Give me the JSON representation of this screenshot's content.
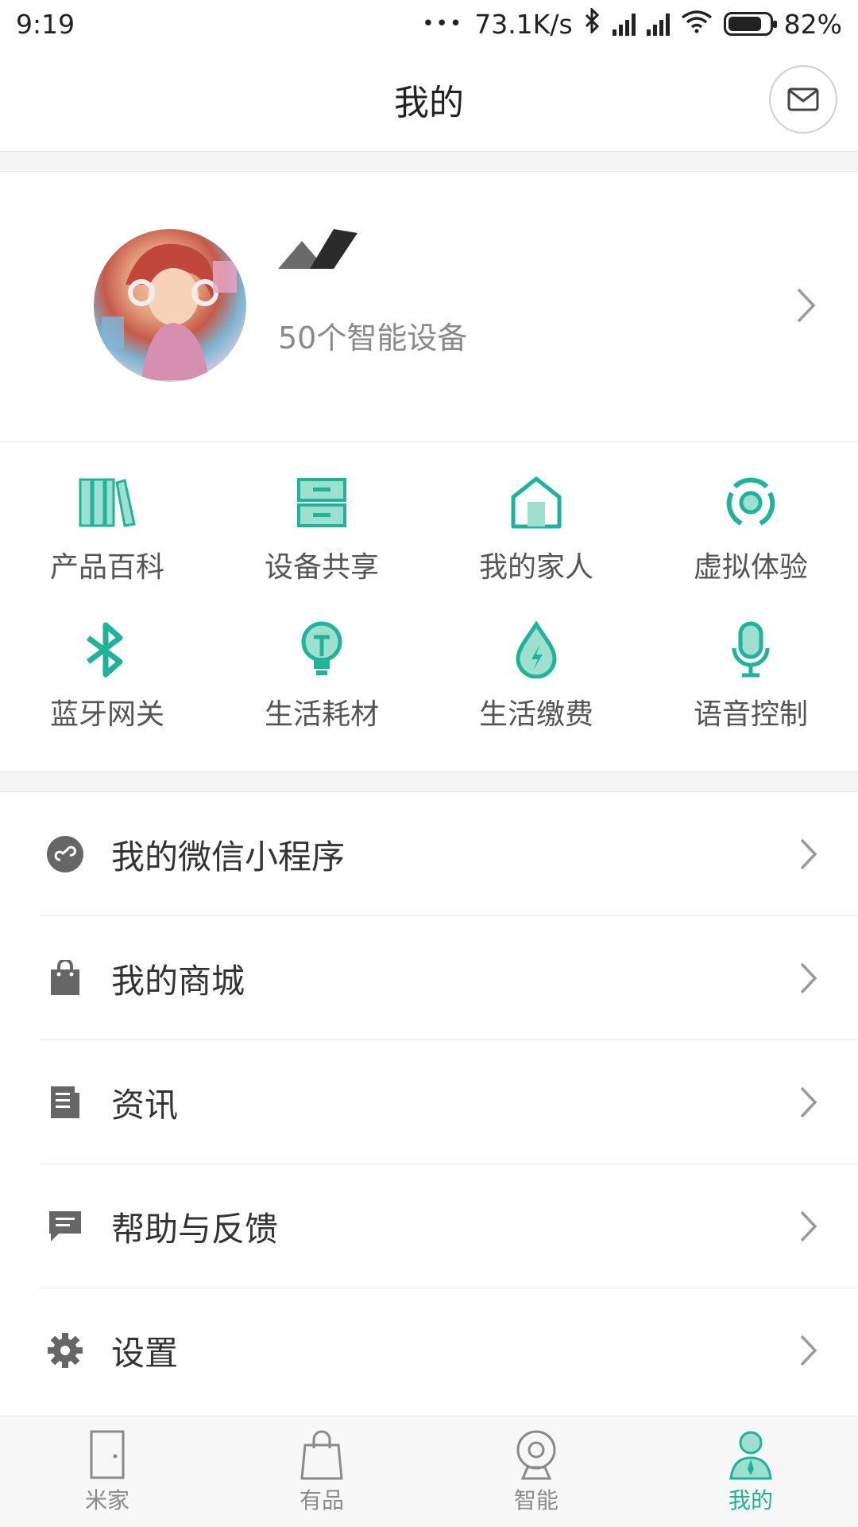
{
  "status": {
    "time": "9:19",
    "more": "•••",
    "net_speed": "73.1K/s",
    "battery": "82%",
    "battery_level": 0.82
  },
  "header": {
    "title": "我的"
  },
  "profile": {
    "device_count": "50个智能设备"
  },
  "grid": {
    "items": [
      {
        "label": "产品百科",
        "icon": "books-icon"
      },
      {
        "label": "设备共享",
        "icon": "drawer-icon"
      },
      {
        "label": "我的家人",
        "icon": "home-icon"
      },
      {
        "label": "虚拟体验",
        "icon": "target-icon"
      },
      {
        "label": "蓝牙网关",
        "icon": "bluetooth-icon"
      },
      {
        "label": "生活耗材",
        "icon": "bulb-icon"
      },
      {
        "label": "生活缴费",
        "icon": "water-drop-icon"
      },
      {
        "label": "语音控制",
        "icon": "microphone-icon"
      }
    ]
  },
  "menu": {
    "items": [
      {
        "label": "我的微信小程序",
        "icon": "mini-program-icon"
      },
      {
        "label": "我的商城",
        "icon": "shopping-bag-icon"
      },
      {
        "label": "资讯",
        "icon": "news-icon"
      },
      {
        "label": "帮助与反馈",
        "icon": "feedback-icon"
      },
      {
        "label": "设置",
        "icon": "gear-icon"
      }
    ]
  },
  "tabs": [
    {
      "label": "米家",
      "icon": "door-icon",
      "active": false
    },
    {
      "label": "有品",
      "icon": "bag-icon",
      "active": false
    },
    {
      "label": "智能",
      "icon": "camera-icon",
      "active": false
    },
    {
      "label": "我的",
      "icon": "person-icon",
      "active": true
    }
  ],
  "colors": {
    "accent": "#1fb39a",
    "icon_gray": "#555555",
    "text": "#333333"
  }
}
